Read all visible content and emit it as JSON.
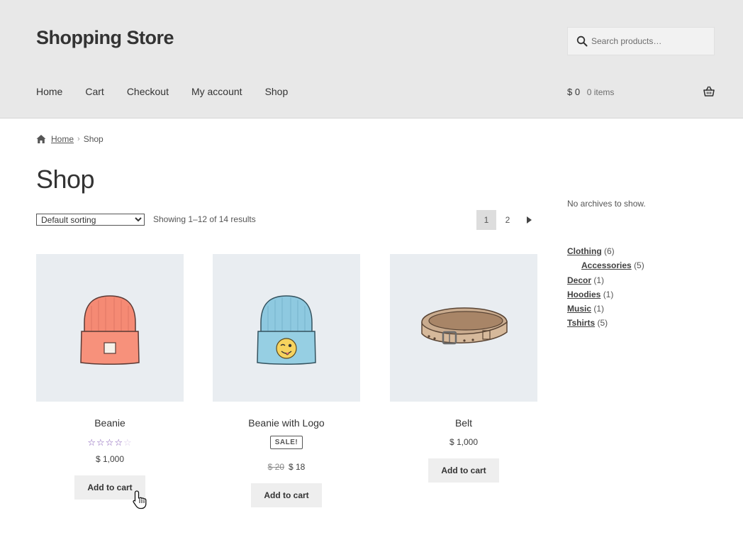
{
  "header": {
    "site_title": "Shopping Store",
    "search_placeholder": "Search products…",
    "nav": [
      "Home",
      "Cart",
      "Checkout",
      "My account",
      "Shop"
    ],
    "cart_amount": "$ 0",
    "cart_count": "0 items"
  },
  "breadcrumb": {
    "home": "Home",
    "separator": "›",
    "current": "Shop"
  },
  "page_title": "Shop",
  "toolbar": {
    "sort_selected": "Default sorting",
    "result_count": "Showing 1–12 of 14 results",
    "pages": [
      "1",
      "2"
    ],
    "current_page": "1"
  },
  "products": [
    {
      "title": "Beanie",
      "rating": 3.5,
      "rating_max": 5,
      "price": "$ 1,000",
      "button": "Add to cart",
      "image": "orange-beanie"
    },
    {
      "title": "Beanie with Logo",
      "sale_badge": "SALE!",
      "old_price": "$ 20",
      "price": "$ 18",
      "button": "Add to cart",
      "image": "blue-beanie-with-emoji"
    },
    {
      "title": "Belt",
      "price": "$ 1,000",
      "button": "Add to cart",
      "image": "leather-belt"
    }
  ],
  "sidebar": {
    "archives_text": "No archives to show.",
    "categories": [
      {
        "name": "Clothing",
        "count": "(6)",
        "child": false
      },
      {
        "name": "Accessories",
        "count": "(5)",
        "child": true
      },
      {
        "name": "Decor",
        "count": "(1)",
        "child": false
      },
      {
        "name": "Hoodies",
        "count": "(1)",
        "child": false
      },
      {
        "name": "Music",
        "count": "(1)",
        "child": false
      },
      {
        "name": "Tshirts",
        "count": "(5)",
        "child": false
      }
    ]
  },
  "colors": {
    "header_bg": "#e8e8e8",
    "image_bg": "#e9edf1",
    "star": "#7f54b3",
    "button_bg": "#eeeeee"
  },
  "icons": [
    "search-icon",
    "basket-icon",
    "home-icon",
    "next-page-icon",
    "pointer-cursor-icon"
  ]
}
